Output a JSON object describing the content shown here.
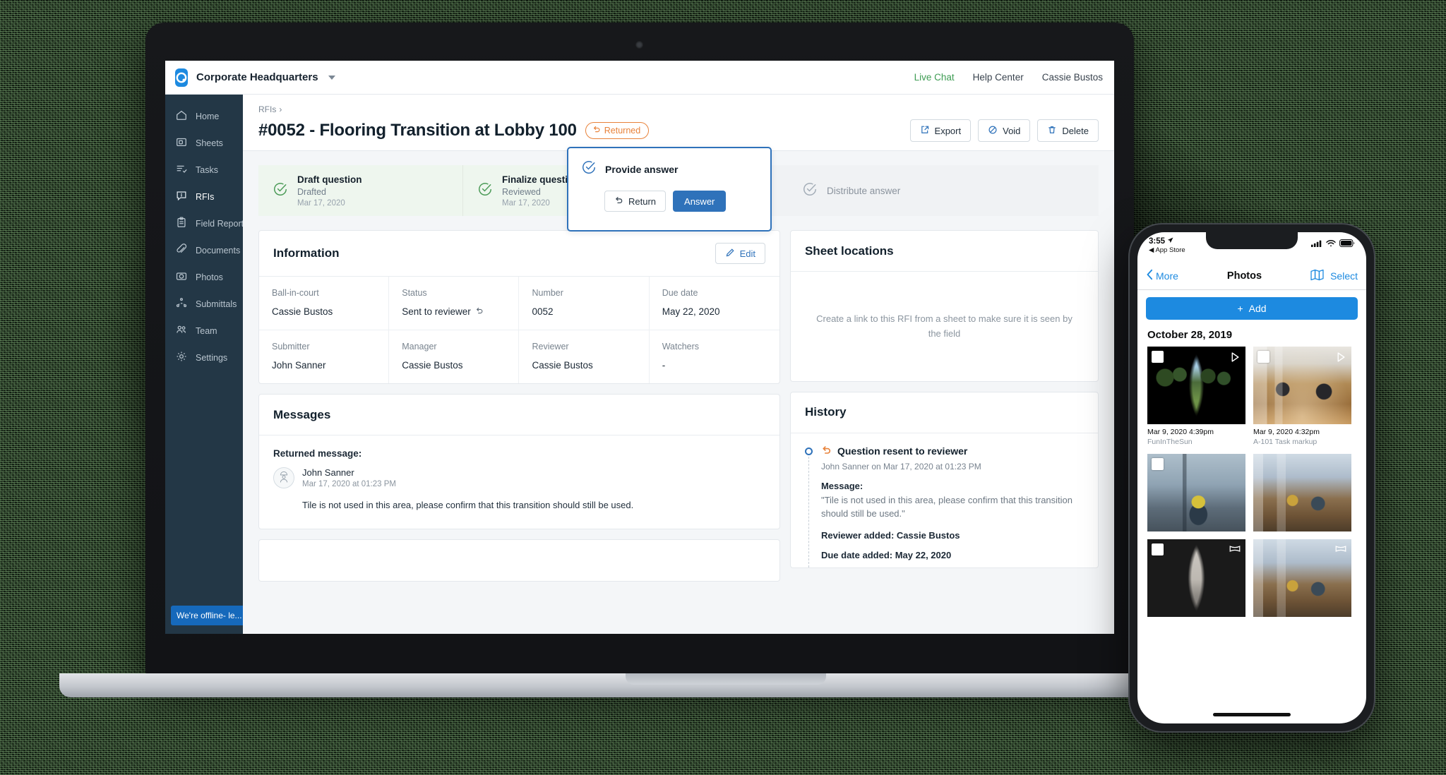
{
  "topbar": {
    "brand_name": "Corporate Headquarters",
    "logo_icon": "circle-logo-icon",
    "caret_icon": "chevron-down-icon",
    "links": [
      {
        "label": "Live Chat",
        "name": "live-chat-link",
        "color": "#3e9c53"
      },
      {
        "label": "Help Center",
        "name": "help-center-link",
        "color": "#39434e"
      },
      {
        "label": "Cassie Bustos",
        "name": "user-menu-link",
        "color": "#39434e"
      }
    ]
  },
  "sidebar": {
    "items": [
      {
        "label": "Home",
        "icon": "home-icon"
      },
      {
        "label": "Sheets",
        "icon": "sheets-icon"
      },
      {
        "label": "Tasks",
        "icon": "tasks-icon"
      },
      {
        "label": "RFIs",
        "icon": "rfi-icon"
      },
      {
        "label": "Field Reports",
        "icon": "clipboard-icon"
      },
      {
        "label": "Documents",
        "icon": "paperclip-icon"
      },
      {
        "label": "Photos",
        "icon": "camera-icon"
      },
      {
        "label": "Submittals",
        "icon": "submittals-icon"
      },
      {
        "label": "Team",
        "icon": "people-icon"
      },
      {
        "label": "Settings",
        "icon": "gear-icon"
      }
    ],
    "offline_chip": {
      "label": "We're offline- le...",
      "icon": "chat-box-icon",
      "color": "#1669bb"
    }
  },
  "page": {
    "breadcrumb": "RFIs",
    "breadcrumb_chevron": "›",
    "title": "#0052 - Flooring Transition at Lobby 100",
    "status_badge": {
      "label": "Returned",
      "icon": "undo-icon",
      "color": "#e8823a"
    },
    "actions": [
      {
        "label": "Export",
        "icon": "export-icon"
      },
      {
        "label": "Void",
        "icon": "void-icon"
      },
      {
        "label": "Delete",
        "icon": "trash-icon"
      }
    ]
  },
  "stepper": {
    "steps": [
      {
        "title": "Draft question",
        "sub": "Drafted",
        "date": "Mar 17, 2020",
        "state": "done",
        "icon": "check-circle-icon"
      },
      {
        "title": "Finalize question",
        "sub": "Reviewed",
        "date": "Mar 17, 2020",
        "state": "done",
        "icon": "check-circle-icon"
      },
      {
        "title": "Distribute answer",
        "sub": "",
        "date": "",
        "state": "todo",
        "icon": "check-circle-icon"
      }
    ],
    "active": {
      "title": "Provide answer",
      "icon": "check-circle-icon",
      "return_label": "Return",
      "return_icon": "undo-icon",
      "answer_label": "Answer",
      "accent": "#2f72ba"
    }
  },
  "information": {
    "title": "Information",
    "edit_label": "Edit",
    "edit_icon": "pencil-icon",
    "fields": [
      {
        "label": "Ball-in-court",
        "value": "Cassie Bustos",
        "suffix_icon": ""
      },
      {
        "label": "Status",
        "value": "Sent to reviewer",
        "suffix_icon": "undo-icon"
      },
      {
        "label": "Number",
        "value": "0052",
        "suffix_icon": ""
      },
      {
        "label": "Due date",
        "value": "May 22, 2020",
        "suffix_icon": ""
      },
      {
        "label": "Submitter",
        "value": "John Sanner",
        "suffix_icon": ""
      },
      {
        "label": "Manager",
        "value": "Cassie Bustos",
        "suffix_icon": ""
      },
      {
        "label": "Reviewer",
        "value": "Cassie Bustos",
        "suffix_icon": ""
      },
      {
        "label": "Watchers",
        "value": "-",
        "suffix_icon": ""
      }
    ]
  },
  "messages": {
    "title": "Messages",
    "returned_label": "Returned message:",
    "author": "John Sanner",
    "timestamp": "Mar 17, 2020 at 01:23 PM",
    "avatar_icon": "person-hardhat-icon",
    "body": "Tile is not used in this area, please confirm that this transition should still be used."
  },
  "sheet_locations": {
    "title": "Sheet locations",
    "empty_text": "Create a link to this RFI from a sheet to make sure it is seen by the field"
  },
  "history": {
    "title": "History",
    "entry": {
      "title": "Question resent to reviewer",
      "title_icon": "undo-icon",
      "meta": "John Sanner on Mar 17, 2020 at 01:23 PM",
      "message_label": "Message:",
      "message_quote": "\"Tile is not used in this area, please confirm that this transition should still be used.\"",
      "reviewer_added": "Reviewer added: Cassie Bustos",
      "due_date_added": "Due date added: May 22, 2020"
    }
  },
  "phone": {
    "status": {
      "time": "3:55",
      "location_icon": "location-arrow-icon",
      "back_app": "App Store",
      "back_icon": "back-triangle-icon",
      "signal_icon": "signal-bars-icon",
      "wifi_icon": "wifi-icon",
      "battery_icon": "battery-icon"
    },
    "navbar": {
      "back_label": "More",
      "back_icon": "chevron-left-icon",
      "title": "Photos",
      "map_icon": "map-icon",
      "select_label": "Select"
    },
    "add_button": {
      "label": "Add",
      "icon": "plus-icon",
      "color": "#1d8ae0"
    },
    "date_header": "October 28, 2019",
    "photos": [
      {
        "caption": "Mar 9, 2020 4:39pm",
        "subcaption": "FunInTheSun",
        "badge_icon": "play-icon",
        "art": "art-park"
      },
      {
        "caption": "Mar 9, 2020 4:32pm",
        "subcaption": "A-101 Task markup",
        "badge_icon": "play-icon",
        "art": "art-office"
      },
      {
        "caption": "",
        "subcaption": "",
        "badge_icon": "",
        "art": "art-site"
      },
      {
        "caption": "",
        "subcaption": "",
        "badge_icon": "",
        "art": "art-atrium"
      },
      {
        "caption": "",
        "subcaption": "",
        "badge_icon": "pano-icon",
        "art": "art-room"
      },
      {
        "caption": "",
        "subcaption": "",
        "badge_icon": "pano-icon",
        "art": "art-atrium"
      }
    ]
  }
}
